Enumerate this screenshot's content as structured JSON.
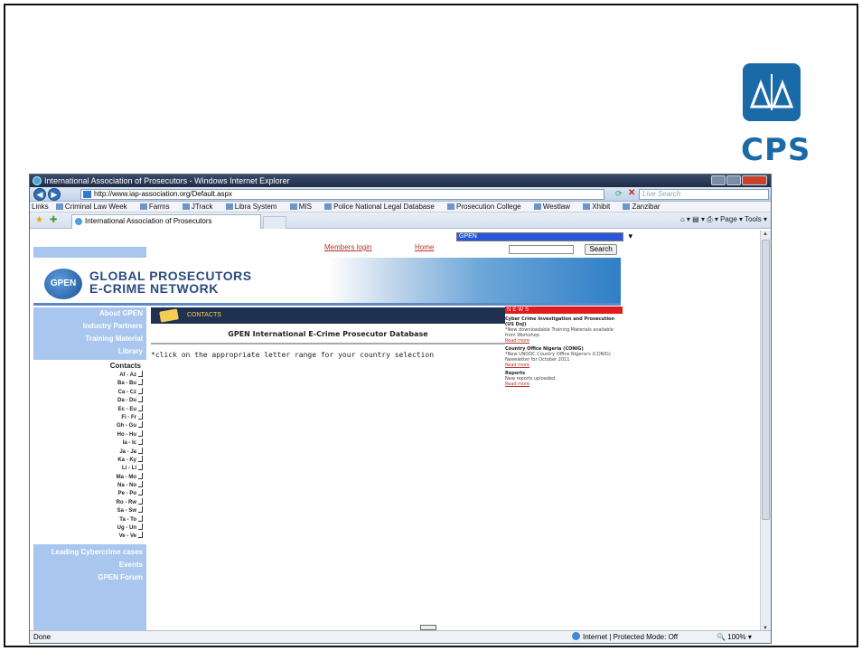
{
  "slide": {
    "logo_text": "CPS"
  },
  "window": {
    "title": "International Association of Prosecutors - Windows Internet Explorer",
    "address": "http://www.iap-association.org/Default.aspx",
    "search_placeholder": "Live Search",
    "links_label": "Links",
    "links": [
      "Criminal Law Week",
      "Farms",
      "JTrack",
      "Libra System",
      "MIS",
      "Police National Legal Database",
      "Prosecution College",
      "Westlaw",
      "Xhibit",
      "Zanzibar"
    ],
    "tab_title": "International Association of Prosecutors",
    "command_bar": "Page ▾   Tools ▾"
  },
  "page": {
    "gpen_select_value": "GPEN",
    "members_login": "Members login",
    "home": "Home",
    "search_button": "Search",
    "brand_short": "GPEN",
    "brand_line1": "GLOBAL PROSECUTORS",
    "brand_line2": "E-CRIME NETWORK",
    "nav_top": [
      "About GPEN",
      "Industry Partners",
      "Training Material",
      "Library"
    ],
    "contacts_title": "Contacts",
    "ranges": [
      "Af - Az",
      "Ba - Bu",
      "Ca - Cz",
      "Da - Du",
      "Ec - Eu",
      "Fi - Fr",
      "Gh - Gu",
      "Ho - Hu",
      "Ia - Ic",
      "Ja - Ja",
      "Ka - Ky",
      "Li - Li",
      "Ma - Mo",
      "Na - No",
      "Pe - Po",
      "Ro - Rw",
      "Sa - Sw",
      "Ta - To",
      "Ug - Un",
      "Ve - Ve"
    ],
    "nav_bottom": [
      "Leading Cybercrime cases",
      "Events",
      "GPEN Forum"
    ],
    "contacts_header": "CONTACTS",
    "db_title": "GPEN International E-Crime Prosecutor Database",
    "instruction": "*click on the appropriate letter range for your country selection",
    "news_header": "NEWS",
    "news": [
      {
        "title": "Cyber Crime Investigation and Prosecution (US DoJ)",
        "body": "*New downloadable Training Materials available from Workshop",
        "more": "Read more"
      },
      {
        "title": "Country Office Nigeria (CONIG)",
        "body": "*New UNODC Country Office Nigeria's (CONIG) Newsletter for October 2011",
        "more": "Read more"
      },
      {
        "title": "Reports",
        "body": "New reports uploaded",
        "more": "Read more"
      }
    ]
  },
  "status": {
    "left": "Done",
    "zone": "Internet | Protected Mode: Off",
    "zoom": "100%"
  }
}
